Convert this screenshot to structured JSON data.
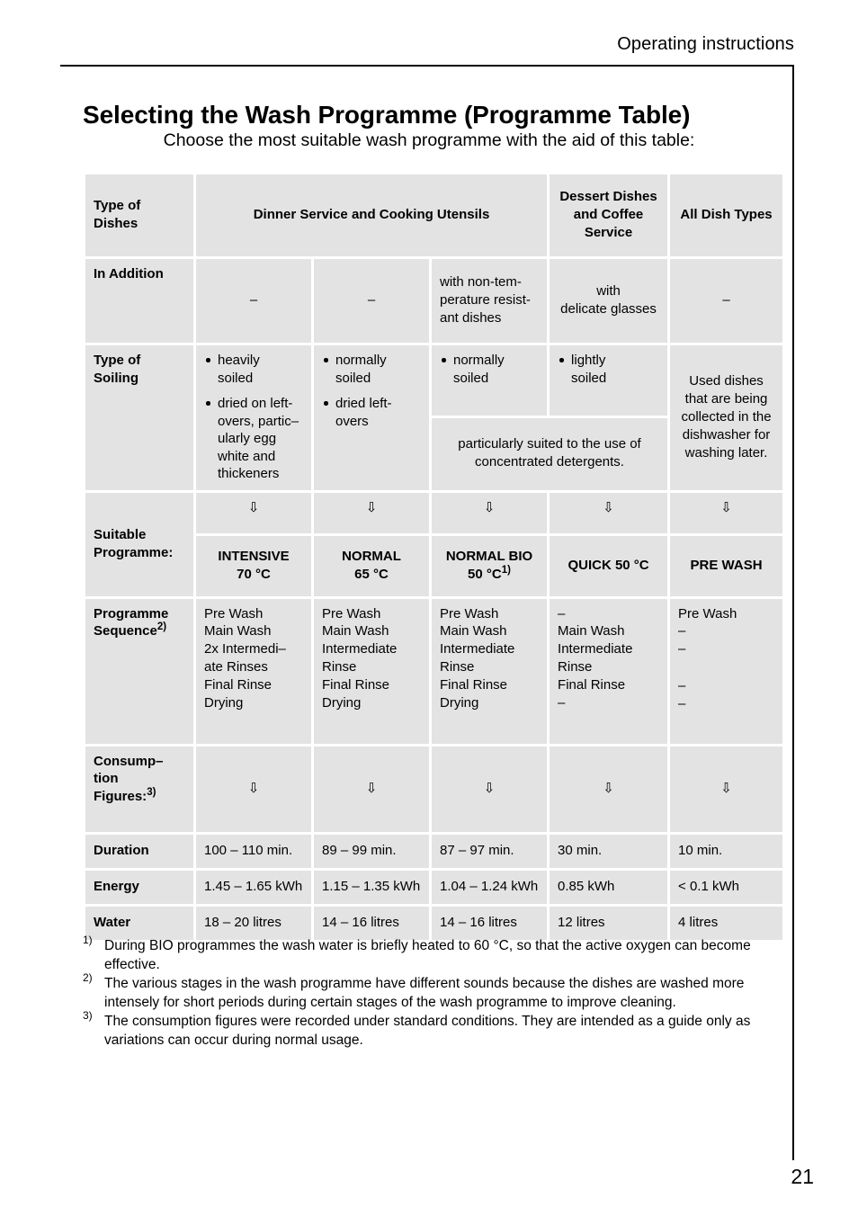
{
  "header": {
    "running_head": "Operating instructions",
    "title": "Selecting the Wash Programme (Programme Table)",
    "subtitle": "Choose the most suitable wash programme with the aid of this table:"
  },
  "table": {
    "row_labels": {
      "type_of_dishes": "Type of\nDishes",
      "in_addition": "In Addition",
      "type_of_soiling": "Type of\nSoiling",
      "suitable_programme": "Suitable\nProgramme:",
      "programme_sequence": "Programme\nSequence",
      "programme_sequence_note": "2)",
      "consumption_figures": "Consump–\ntion\nFigures:",
      "consumption_figures_note": "3)",
      "duration": "Duration",
      "energy": "Energy",
      "water": "Water"
    },
    "dish_type_headers": {
      "dinner_service": "Dinner Service and Cooking Utensils",
      "dessert_dishes": "Dessert Dishes\nand Coffee\nService",
      "all_dish_types": "All Dish Types"
    },
    "in_addition": [
      "–",
      "–",
      "with non-tem-\nperature resist-\nant dishes",
      "with\ndelicate glasses",
      "–"
    ],
    "soiling": {
      "col1": [
        "heavily\nsoiled",
        "dried on left-\novers, partic–\nularly egg\nwhite and\nthickeners"
      ],
      "col2": [
        "normally\nsoiled",
        "dried left-\novers"
      ],
      "col3": [
        "normally\nsoiled"
      ],
      "col4": [
        "lightly\nsoiled"
      ],
      "concentrated_note": "particularly suited to the use of\nconcentrated detergents.",
      "col5": "Used dishes\nthat are being\ncollected in the\ndishwasher for\nwashing later."
    },
    "arrow_icon": "⇩",
    "programmes": [
      {
        "name": "INTENSIVE",
        "temp": "70 °C",
        "note": ""
      },
      {
        "name": "NORMAL",
        "temp": "65 °C",
        "note": ""
      },
      {
        "name": "NORMAL BIO",
        "temp": "50 °C",
        "note": "1)"
      },
      {
        "name": "QUICK 50 °C",
        "temp": "",
        "note": ""
      },
      {
        "name": "PRE WASH",
        "temp": "",
        "note": ""
      }
    ],
    "sequences": [
      [
        "Pre Wash",
        "Main Wash",
        "2x Intermedi–",
        "ate Rinses",
        "Final Rinse",
        "Drying"
      ],
      [
        "Pre Wash",
        "Main Wash",
        "Intermediate",
        "Rinse",
        "Final Rinse",
        "Drying"
      ],
      [
        "Pre Wash",
        "Main Wash",
        "Intermediate",
        "Rinse",
        "Final Rinse",
        "Drying"
      ],
      [
        "–",
        "Main Wash",
        "Intermediate",
        "Rinse",
        "Final Rinse",
        "–"
      ],
      [
        "Pre Wash",
        "–",
        "–",
        "",
        "–",
        "–"
      ]
    ],
    "duration": [
      "100 – 110 min.",
      "89 – 99 min.",
      "87 – 97 min.",
      "30 min.",
      "10 min."
    ],
    "energy": [
      "1.45 – 1.65 kWh",
      "1.15 – 1.35 kWh",
      "1.04 – 1.24 kWh",
      "0.85 kWh",
      "< 0.1 kWh"
    ],
    "water": [
      "18 – 20 litres",
      "14 – 16 litres",
      "14 – 16 litres",
      "12 litres",
      "4 litres"
    ]
  },
  "footnotes": [
    {
      "mark": "1)",
      "text": "During BIO programmes the wash water is briefly heated to 60 °C, so that the active oxygen can become effective."
    },
    {
      "mark": "2)",
      "text": "The various stages in the wash programme have different sounds because the dishes are washed more intensely for short periods during certain stages of the wash programme to improve cleaning."
    },
    {
      "mark": "3)",
      "text": "The consumption figures were recorded under standard conditions. They are intended as a guide only as variations can occur during normal usage."
    }
  ],
  "page_number": "21",
  "colors": {
    "cell_bg": "#e3e3e3",
    "text": "#000000",
    "page_bg": "#ffffff"
  }
}
